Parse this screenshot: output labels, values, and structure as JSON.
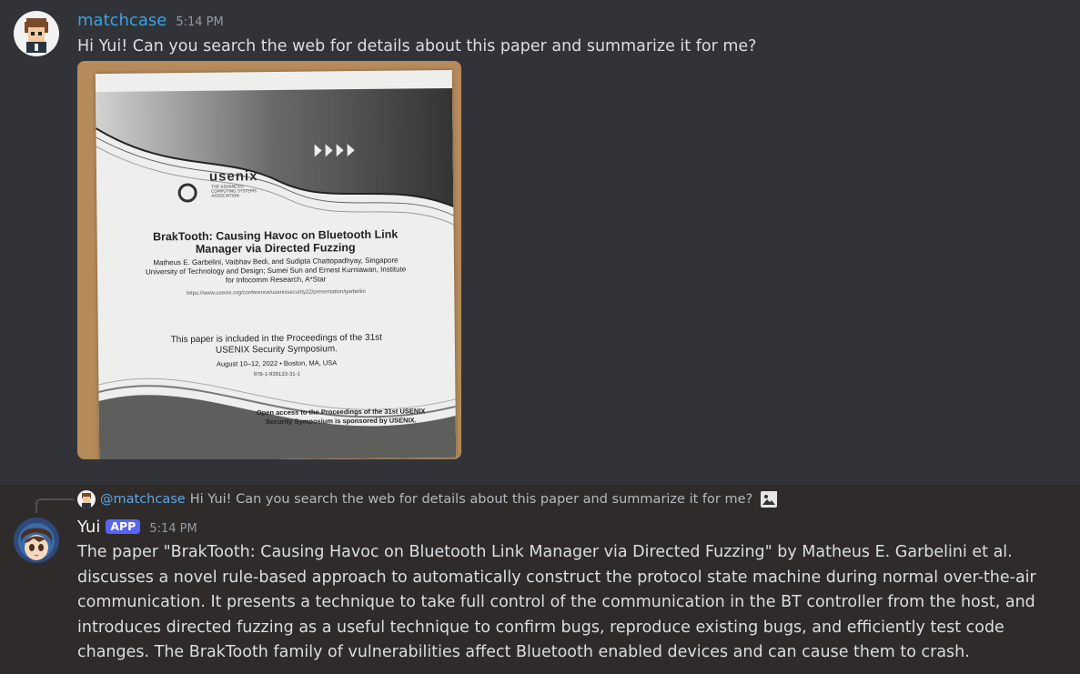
{
  "messages": [
    {
      "author": "matchcase",
      "time": "5:14 PM",
      "text": "Hi Yui! Can you search the web for details about this paper and summarize it for me?",
      "attachment": {
        "usenix_word": "usenix",
        "usenix_sub": "THE ADVANCED COMPUTING SYSTEMS ASSOCIATION",
        "title": "BrakTooth: Causing Havoc on Bluetooth Link Manager via Directed Fuzzing",
        "authors": "Matheus E. Garbelini, Vaibhav Bedi, and Sudipta Chattopadhyay, Singapore University of Technology and Design; Sumei Sun and Ernest Kurniawan, Institute for Infocomm Research, A*Star",
        "url": "https://www.usenix.org/conference/usenixsecurity22/presentation/garbelini",
        "proceedings": "This paper is included in the Proceedings of the 31st USENIX Security Symposium.",
        "dates": "August 10–12, 2022 • Boston, MA, USA",
        "isbn": "978-1-939133-31-1",
        "open_access": "Open access to the Proceedings of the 31st USENIX Security Symposium is sponsored by USENIX."
      }
    },
    {
      "reply": {
        "mention": "@matchcase",
        "text": "Hi Yui! Can you search the web for details about this paper and summarize it for me?",
        "icon": "image-icon"
      },
      "author": "Yui",
      "badge": "APP",
      "time": "5:14 PM",
      "text": "The paper \"BrakTooth: Causing Havoc on Bluetooth Link Manager via Directed Fuzzing\" by Matheus E. Garbelini et al. discusses a novel rule-based approach to automatically construct the protocol state machine during normal over-the-air communication. It presents a technique to take full control of the communication in the BT controller from the host, and introduces directed fuzzing as a useful technique to confirm bugs, reproduce existing bugs, and efficiently test code changes. The BrakTooth family of vulnerabilities affect Bluetooth enabled devices and can cause them to crash."
    }
  ],
  "colors": {
    "background": "#313338",
    "highlight_background": "#2e2b2a",
    "username_1": "#3aa3e3",
    "mention": "#5fa7e8",
    "app_badge": "#5865f2"
  }
}
